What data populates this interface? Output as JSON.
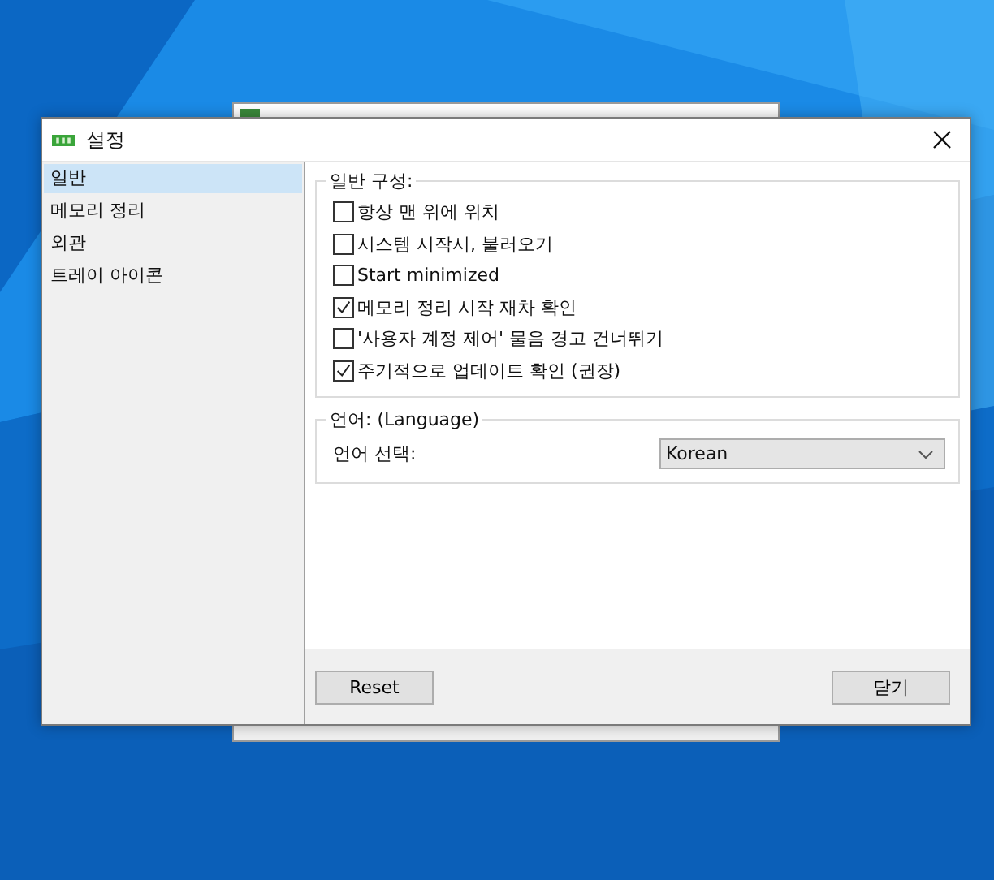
{
  "window": {
    "title": "설정"
  },
  "sidebar": {
    "items": [
      {
        "label": "일반",
        "selected": true
      },
      {
        "label": "메모리 정리",
        "selected": false
      },
      {
        "label": "외관",
        "selected": false
      },
      {
        "label": "트레이 아이콘",
        "selected": false
      }
    ]
  },
  "general": {
    "title": "일반 구성:",
    "options": [
      {
        "label": "항상 맨 위에 위치",
        "checked": false
      },
      {
        "label": "시스템 시작시, 불러오기",
        "checked": false
      },
      {
        "label": "Start minimized",
        "checked": false
      },
      {
        "label": "메모리 정리 시작 재차 확인",
        "checked": true
      },
      {
        "label": "'사용자 계정 제어' 물음 경고 건너뛰기",
        "checked": false
      },
      {
        "label": "주기적으로 업데이트 확인 (권장)",
        "checked": true
      }
    ]
  },
  "language": {
    "title": "언어: (Language)",
    "label": "언어 선택:",
    "value": "Korean"
  },
  "buttons": [
    {
      "label": "Reset"
    },
    {
      "label": "닫기"
    }
  ]
}
